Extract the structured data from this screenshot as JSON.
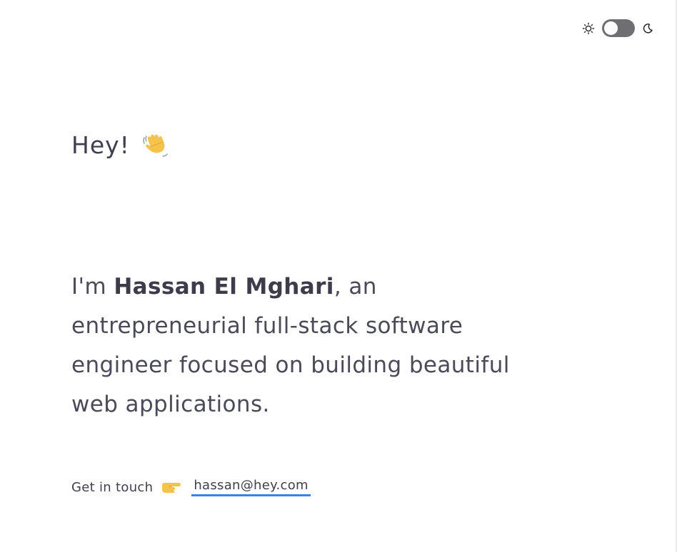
{
  "theme_toggle": {
    "light_icon": "sun-icon",
    "dark_icon": "moon-icon",
    "mode": "light"
  },
  "greeting": {
    "text": "Hey!",
    "emoji_icon": "waving-hand-icon"
  },
  "intro": {
    "prefix": "I'm ",
    "name": "Hassan El Mghari",
    "suffix": ", an entrepreneurial full-stack software engineer focused on building beautiful web applications."
  },
  "contact": {
    "label": "Get in touch",
    "pointer_icon": "pointing-hand-icon",
    "email": "hassan@hey.com"
  },
  "colors": {
    "text": "#3f3f4e",
    "accent": "#3f7fe6",
    "toggle_track": "#6e6e73"
  }
}
